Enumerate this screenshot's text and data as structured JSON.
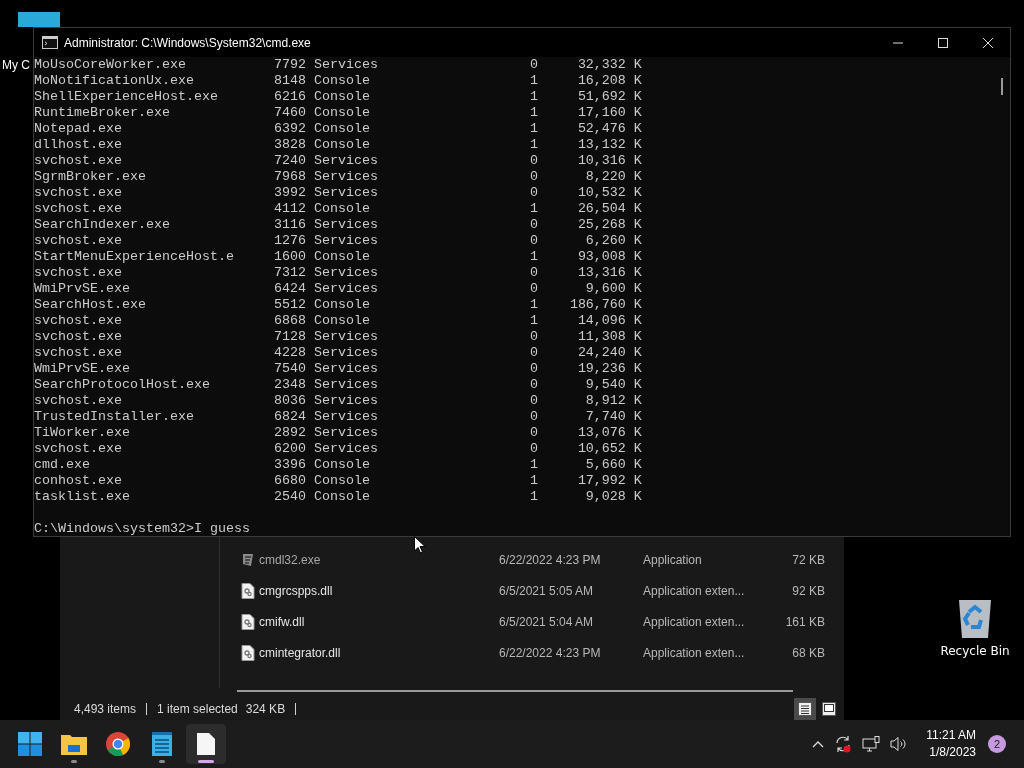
{
  "desktop": {
    "icons": [
      {
        "kind": "computer",
        "label": "My C"
      },
      {
        "kind": "recycle",
        "label": "Recycle Bin"
      }
    ]
  },
  "console": {
    "title": "Administrator: C:\\Windows\\System32\\cmd.exe",
    "processes": [
      {
        "image": "MoUsoCoreWorker.exe",
        "pid": "7792",
        "session_name": "Services",
        "session": "0",
        "mem": "32,332 K"
      },
      {
        "image": "MoNotificationUx.exe",
        "pid": "8148",
        "session_name": "Console",
        "session": "1",
        "mem": "16,208 K"
      },
      {
        "image": "ShellExperienceHost.exe",
        "pid": "6216",
        "session_name": "Console",
        "session": "1",
        "mem": "51,692 K"
      },
      {
        "image": "RuntimeBroker.exe",
        "pid": "7460",
        "session_name": "Console",
        "session": "1",
        "mem": "17,160 K"
      },
      {
        "image": "Notepad.exe",
        "pid": "6392",
        "session_name": "Console",
        "session": "1",
        "mem": "52,476 K"
      },
      {
        "image": "dllhost.exe",
        "pid": "3828",
        "session_name": "Console",
        "session": "1",
        "mem": "13,132 K"
      },
      {
        "image": "svchost.exe",
        "pid": "7240",
        "session_name": "Services",
        "session": "0",
        "mem": "10,316 K"
      },
      {
        "image": "SgrmBroker.exe",
        "pid": "7968",
        "session_name": "Services",
        "session": "0",
        "mem": "8,220 K"
      },
      {
        "image": "svchost.exe",
        "pid": "3992",
        "session_name": "Services",
        "session": "0",
        "mem": "10,532 K"
      },
      {
        "image": "svchost.exe",
        "pid": "4112",
        "session_name": "Console",
        "session": "1",
        "mem": "26,504 K"
      },
      {
        "image": "SearchIndexer.exe",
        "pid": "3116",
        "session_name": "Services",
        "session": "0",
        "mem": "25,268 K"
      },
      {
        "image": "svchost.exe",
        "pid": "1276",
        "session_name": "Services",
        "session": "0",
        "mem": "6,260 K"
      },
      {
        "image": "StartMenuExperienceHost.e",
        "pid": "1600",
        "session_name": "Console",
        "session": "1",
        "mem": "93,008 K"
      },
      {
        "image": "svchost.exe",
        "pid": "7312",
        "session_name": "Services",
        "session": "0",
        "mem": "13,316 K"
      },
      {
        "image": "WmiPrvSE.exe",
        "pid": "6424",
        "session_name": "Services",
        "session": "0",
        "mem": "9,600 K"
      },
      {
        "image": "SearchHost.exe",
        "pid": "5512",
        "session_name": "Console",
        "session": "1",
        "mem": "186,760 K"
      },
      {
        "image": "svchost.exe",
        "pid": "6868",
        "session_name": "Console",
        "session": "1",
        "mem": "14,096 K"
      },
      {
        "image": "svchost.exe",
        "pid": "7128",
        "session_name": "Services",
        "session": "0",
        "mem": "11,308 K"
      },
      {
        "image": "svchost.exe",
        "pid": "4228",
        "session_name": "Services",
        "session": "0",
        "mem": "24,240 K"
      },
      {
        "image": "WmiPrvSE.exe",
        "pid": "7540",
        "session_name": "Services",
        "session": "0",
        "mem": "19,236 K"
      },
      {
        "image": "SearchProtocolHost.exe",
        "pid": "2348",
        "session_name": "Services",
        "session": "0",
        "mem": "9,540 K"
      },
      {
        "image": "svchost.exe",
        "pid": "8036",
        "session_name": "Services",
        "session": "0",
        "mem": "8,912 K"
      },
      {
        "image": "TrustedInstaller.exe",
        "pid": "6824",
        "session_name": "Services",
        "session": "0",
        "mem": "7,740 K"
      },
      {
        "image": "TiWorker.exe",
        "pid": "2892",
        "session_name": "Services",
        "session": "0",
        "mem": "13,076 K"
      },
      {
        "image": "svchost.exe",
        "pid": "6200",
        "session_name": "Services",
        "session": "0",
        "mem": "10,652 K"
      },
      {
        "image": "cmd.exe",
        "pid": "3396",
        "session_name": "Console",
        "session": "1",
        "mem": "5,660 K"
      },
      {
        "image": "conhost.exe",
        "pid": "6680",
        "session_name": "Console",
        "session": "1",
        "mem": "17,992 K"
      },
      {
        "image": "tasklist.exe",
        "pid": "2540",
        "session_name": "Console",
        "session": "1",
        "mem": "9,028 K"
      }
    ],
    "prompt": "C:\\Windows\\system32>I guess"
  },
  "explorer": {
    "files": [
      {
        "kind": "exe",
        "name": "cmdl32.exe",
        "modified": "6/22/2022 4:23 PM",
        "type": "Application",
        "size": "72 KB"
      },
      {
        "kind": "dll",
        "name": "cmgrcspps.dll",
        "modified": "6/5/2021 5:05 AM",
        "type": "Application exten...",
        "size": "92 KB"
      },
      {
        "kind": "dll",
        "name": "cmifw.dll",
        "modified": "6/5/2021 5:04 AM",
        "type": "Application exten...",
        "size": "161 KB"
      },
      {
        "kind": "dll",
        "name": "cmintegrator.dll",
        "modified": "6/22/2022 4:23 PM",
        "type": "Application exten...",
        "size": "68 KB"
      }
    ],
    "status": {
      "items": "4,493 items",
      "selection": "1 item selected",
      "selection_size": "324 KB"
    },
    "views": [
      {
        "kind": "details",
        "selected": true
      },
      {
        "kind": "tiles",
        "selected": false
      }
    ]
  },
  "taskbar": {
    "apps": [
      {
        "kind": "start",
        "running": false,
        "active": false
      },
      {
        "kind": "folder",
        "running": true,
        "active": false
      },
      {
        "kind": "browser",
        "running": false,
        "active": false
      },
      {
        "kind": "notepad",
        "running": true,
        "active": false
      },
      {
        "kind": "file",
        "running": true,
        "active": true
      }
    ],
    "clock": {
      "time": "11:21 AM",
      "date": "1/8/2023"
    },
    "notifications": "2"
  }
}
